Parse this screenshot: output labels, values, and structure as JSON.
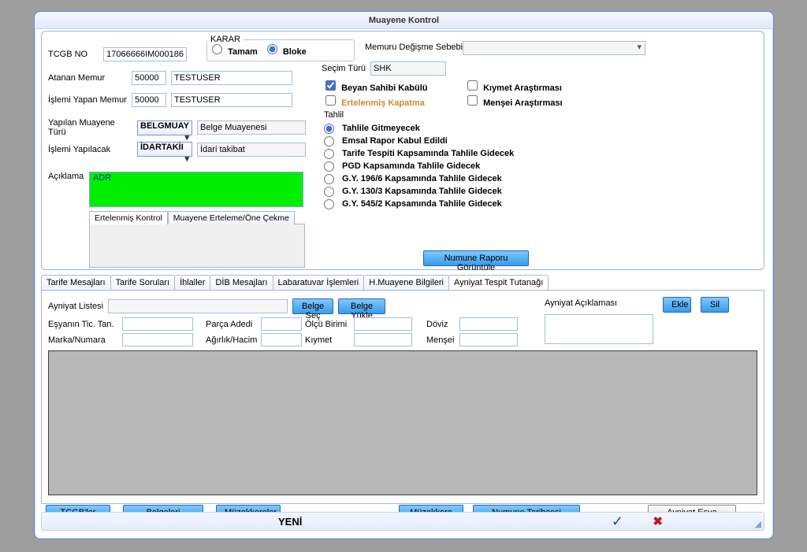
{
  "window": {
    "title": "Muayene Kontrol"
  },
  "header": {
    "tcgb_no_label": "TCGB NO",
    "tcgb_no": "17066666IM000186",
    "karar": {
      "legend": "KARAR",
      "tamam": "Tamam",
      "bloke": "Bloke"
    },
    "memuru_degisme_sebebi_label": "Memuru Değişme Sebebi",
    "secim_turu_label": "Seçim Türü",
    "secim_turu_value": "SHK",
    "atanan_memur_label": "Atanan  Memur",
    "atanan_memur_code": "50000",
    "atanan_memur_name": "TESTUSER",
    "islemi_yapan_label": "İşlemi Yapan  Memur",
    "islemi_yapan_code": "50000",
    "islemi_yapan_name": "TESTUSER",
    "yapilan_muayene_turu_label": "Yapılan Muayene Türü",
    "yapilan_muayene_turu_sel": "BELGMUAY",
    "yapilan_muayene_turu_desc": "Belge Muayenesi",
    "islemi_yapilacak_label": "İşlemi Yapılacak",
    "islemi_yapilacak_sel": "İDARTAKİI",
    "islemi_yapilacak_desc": "İdari takibat",
    "aciklama_label": "Açıklama",
    "aciklama_value": "ADR",
    "checks": {
      "beyan": "Beyan Sahibi Kabülü",
      "kiymet": "Kıymet Araştırması",
      "ertelenmis": "Ertelenmiş Kapatma",
      "mensei": "Menşei Araştırması"
    },
    "tahlil_label": "Tahlil",
    "tahlil_options": [
      "Tahlile Gitmeyecek",
      "Emsal Rapor Kabul Edildi",
      "Tarife Tespiti Kapsamında Tahlile Gidecek",
      "PGD Kapsamında Tahlile Gidecek",
      "G.Y. 196/6 Kapsamında Tahlile Gidecek",
      "G.Y. 130/3 Kapsamında Tahlile Gidecek",
      "G.Y. 545/2 Kapsamında Tahlile Gidecek"
    ],
    "subtabs": {
      "t1": "Ertelenmiş Kontrol",
      "t2": "Muayene Erteleme/Öne Çekme"
    },
    "numune_raporu": "Numune Raporu Görüntüle"
  },
  "tabs": [
    "Tarife Mesajları",
    "Tarife Soruları",
    "İhlaller",
    "DİB Mesajları",
    "Labaratuvar İşlemleri",
    "H.Muayene Bilgileri",
    "Ayniyat Tespit Tutanağı"
  ],
  "ayniyat": {
    "ayniyat_listesi": "Ayniyat Listesi",
    "belge_sec": "Belge Seç",
    "belge_yukle": "Belge Yükle",
    "ayniyat_aciklamasi": "Ayniyat Açıklaması",
    "ekle": "Ekle",
    "sil": "Sil",
    "esyanin_tic_tan": "Eşyanın Tic. Tan.",
    "parca_adedi": "Parça Adedi",
    "olcu_birimi": "Ölçü Birimi",
    "doviz": "Döviz",
    "marka_numara": "Marka/Numara",
    "agirlik_hacim": "Ağırlık/Hacim",
    "kiymet": "Kıymet",
    "mensei": "Menşei"
  },
  "footer": {
    "tcgbler": "TCGB'ler",
    "belgeleri_goruntule": "Belgeleri Görüntüle",
    "muzekkereler": "Müzekkereler",
    "muzekkere": "Müzekkere",
    "numune_tarihcesi": "Numune Tarihçesi Sorgula",
    "ayniyat_esya_sayaci": "Ayniyat Eşya Sayacı",
    "yeni": "YENİ"
  }
}
